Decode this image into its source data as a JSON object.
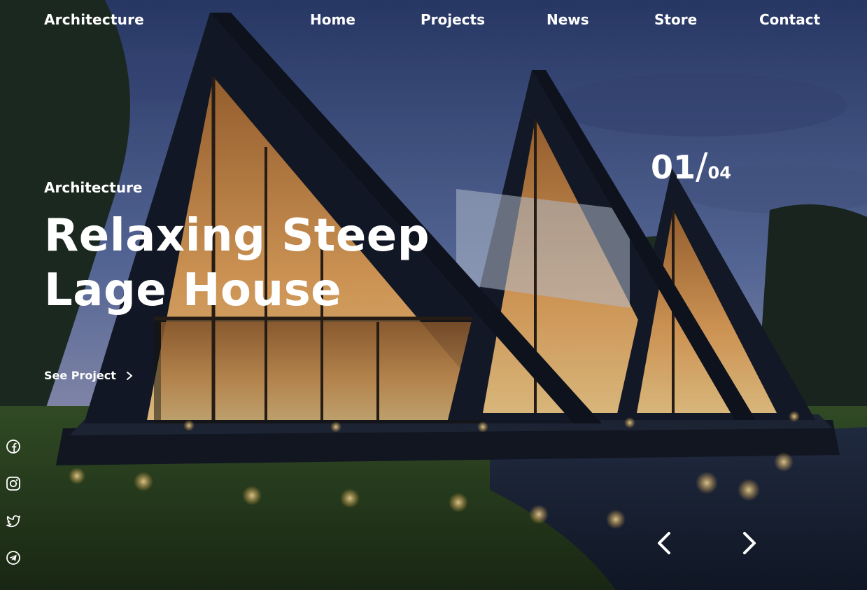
{
  "header": {
    "logo": "Architecture",
    "nav": [
      {
        "label": "Home"
      },
      {
        "label": "Projects"
      },
      {
        "label": "News"
      },
      {
        "label": "Store"
      },
      {
        "label": "Contact"
      }
    ]
  },
  "hero": {
    "eyebrow": "Architecture",
    "title_line1": "Relaxing Steep",
    "title_line2": "Lage House",
    "cta": "See Project"
  },
  "slider": {
    "current": "01",
    "separator": "/",
    "total": "04"
  },
  "social": [
    "facebook-icon",
    "instagram-icon",
    "twitter-icon",
    "telegram-icon"
  ],
  "colors": {
    "text": "#ffffff",
    "sky": "#6f7fb2",
    "roof": "#1b2233",
    "warm_light": "#f0b25c",
    "grass": "#2f4a24"
  }
}
